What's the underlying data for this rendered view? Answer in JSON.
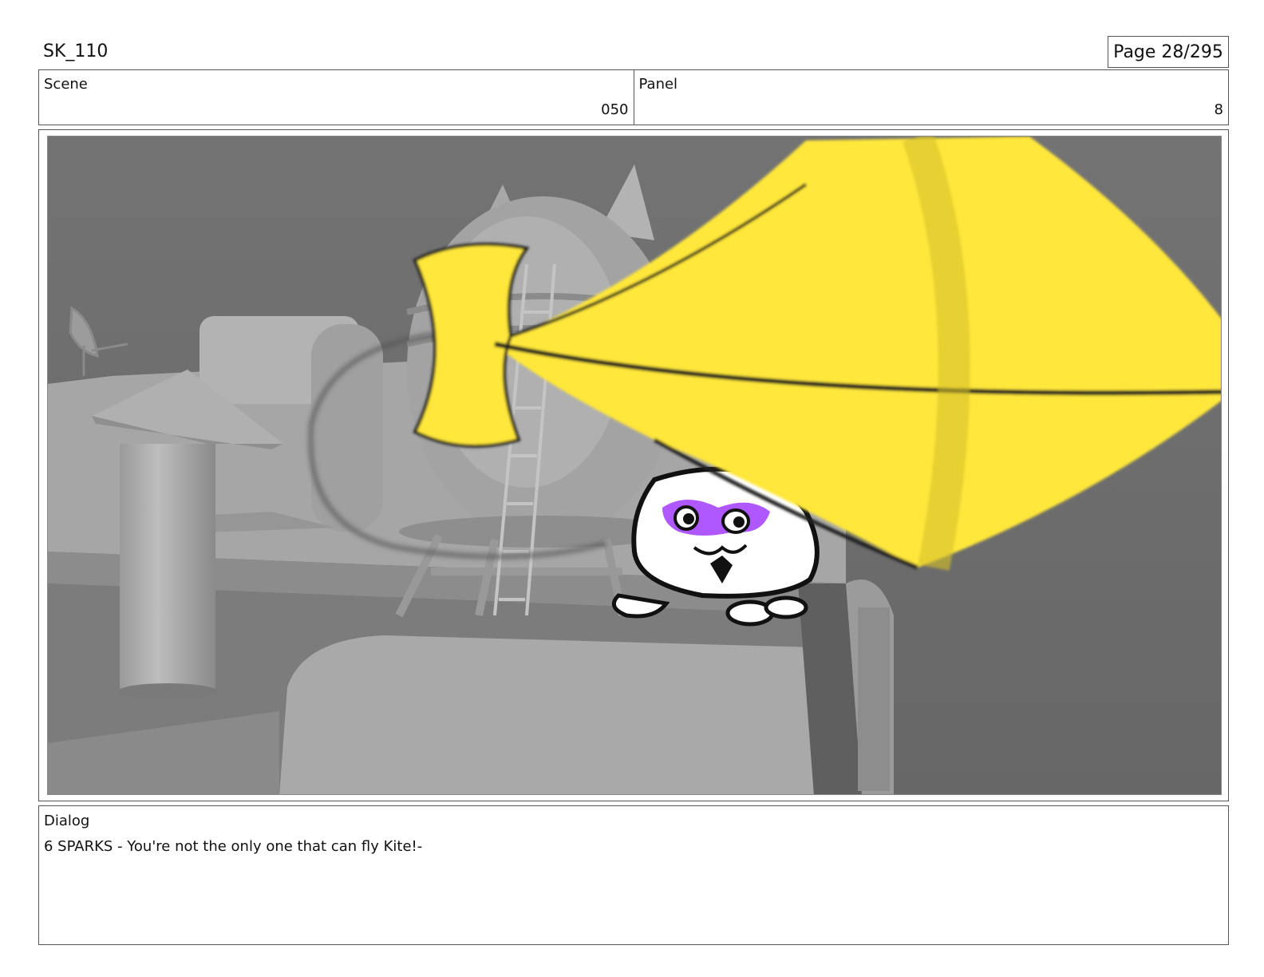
{
  "header": {
    "title": "SK_110",
    "page": "Page  28/295"
  },
  "info": {
    "scene_label": "Scene",
    "scene_value": "050",
    "panel_label": "Panel",
    "panel_value": "8"
  },
  "dialog": {
    "label": "Dialog",
    "text": "6 SPARKS - You're not the only one that can fly Kite!-"
  },
  "colors": {
    "background": "#6d6d6d",
    "kite_yellow": "#ffe73a",
    "accent_purple": "#a23bff"
  }
}
